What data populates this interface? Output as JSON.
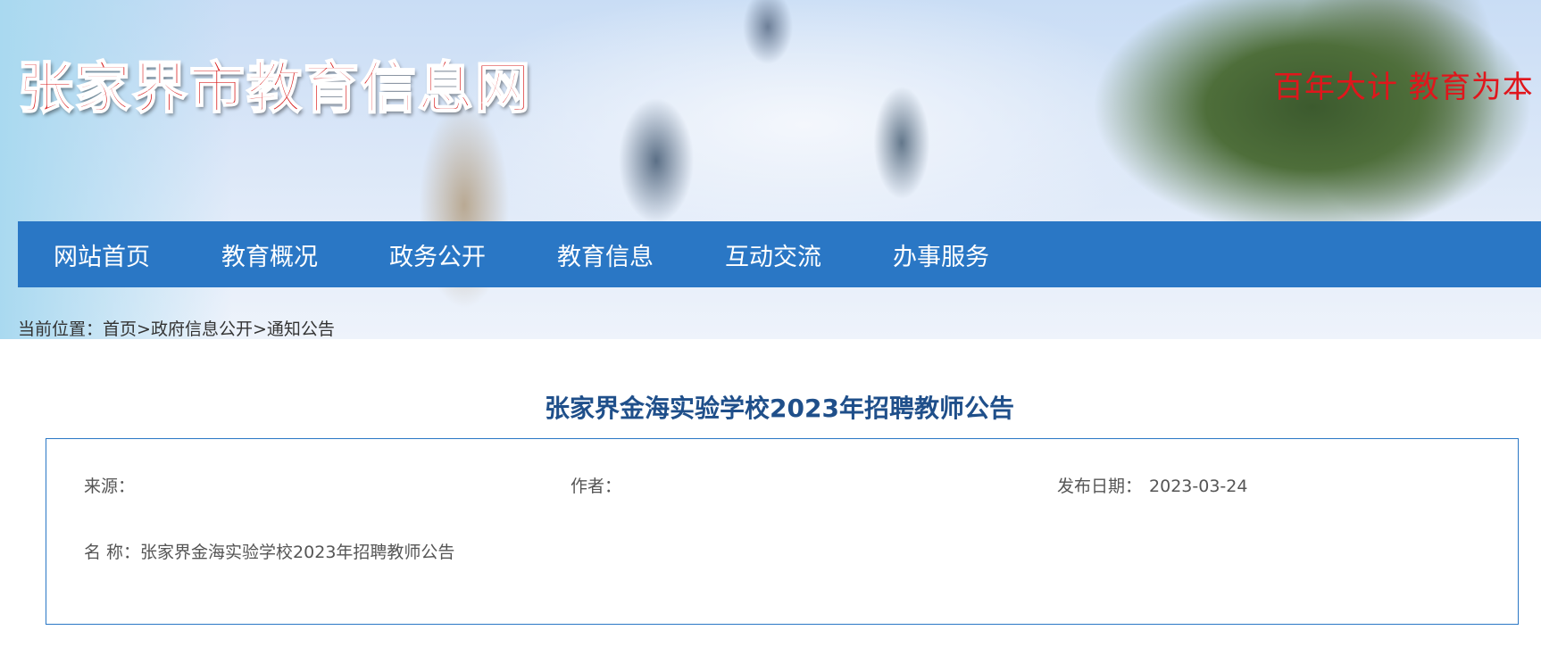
{
  "header": {
    "logo_text": "张家界市教育信息网",
    "slogan": "百年大计  教育为本"
  },
  "nav": {
    "items": [
      {
        "label": "网站首页"
      },
      {
        "label": "教育概况"
      },
      {
        "label": "政务公开"
      },
      {
        "label": "教育信息"
      },
      {
        "label": "互动交流"
      },
      {
        "label": "办事服务"
      }
    ]
  },
  "breadcrumb": {
    "prefix": "当前位置：",
    "items": [
      {
        "label": "首页"
      },
      {
        "label": "政府信息公开"
      },
      {
        "label": "通知公告"
      }
    ],
    "separator": ">"
  },
  "article": {
    "title": "张家界金海实验学校2023年招聘教师公告",
    "source_label": "来源：",
    "source_value": "",
    "author_label": "作者：",
    "author_value": "",
    "date_label": "发布日期：",
    "date_value": "2023-03-24",
    "name_label": "名 称：",
    "name_value": "张家界金海实验学校2023年招聘教师公告"
  },
  "colors": {
    "nav_background": "#2a77c5",
    "title_color": "#1f4f8a",
    "logo_red": "#d81c1c",
    "slogan_red": "#e0161c"
  }
}
